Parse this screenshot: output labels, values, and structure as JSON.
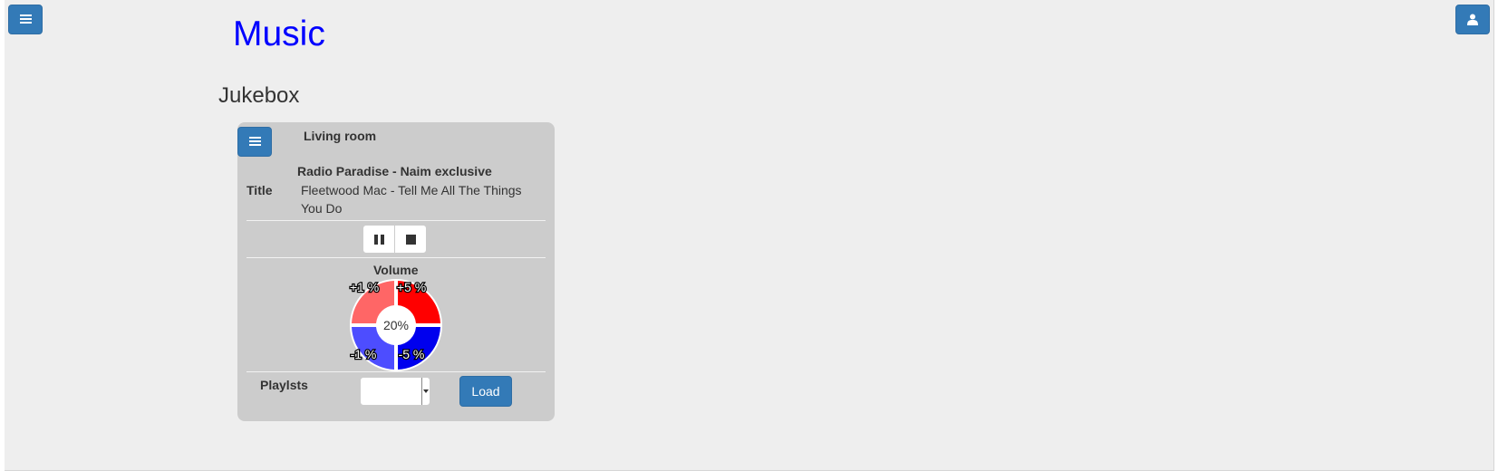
{
  "header": {
    "menu_icon": "hamburger-icon",
    "user_icon": "user-icon",
    "title": "Music"
  },
  "section": {
    "heading": "Jukebox"
  },
  "player": {
    "menu_icon": "hamburger-icon",
    "room": "Living room",
    "station": "Radio Paradise - Naim exclusive",
    "title_label": "Title",
    "track": "Fleetwood Mac - Tell Me All The Things You Do",
    "controls": {
      "pause_icon": "pause-icon",
      "stop_icon": "stop-icon"
    },
    "volume": {
      "label": "Volume",
      "level": "20%",
      "plus_one": "+1 %",
      "plus_five": "+5 %",
      "minus_one": "-1 %",
      "minus_five": "-5 %",
      "colors": {
        "plus_one": "#ff6666",
        "plus_five": "#ff0000",
        "minus_one": "#4d4dff",
        "minus_five": "#0000ee"
      }
    },
    "playlists": {
      "label": "Playlsts",
      "selected": "",
      "load_label": "Load"
    }
  },
  "colors": {
    "accent": "#337ab7",
    "title": "#0000ff",
    "background": "#eeeeee",
    "panel": "#cccccc"
  }
}
